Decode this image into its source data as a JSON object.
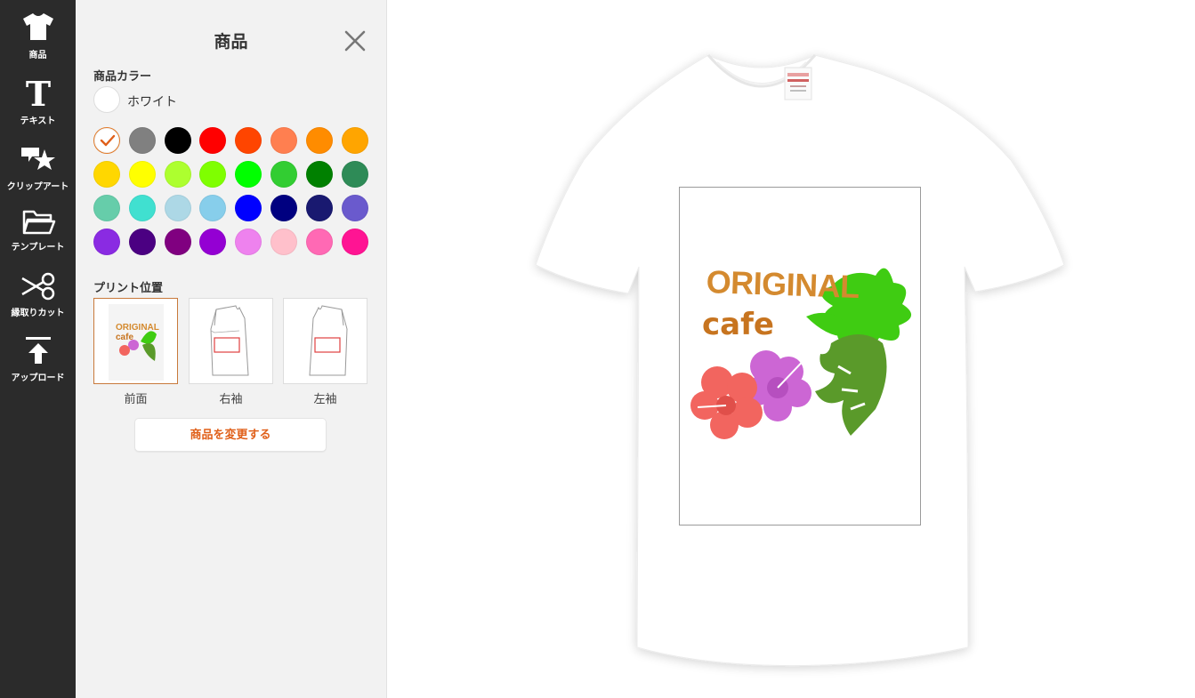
{
  "toolbar": {
    "items": [
      {
        "label": "商品",
        "icon": "tshirt-icon"
      },
      {
        "label": "テキスト",
        "icon": "text-icon"
      },
      {
        "label": "クリップアート",
        "icon": "clipart-icon"
      },
      {
        "label": "テンプレート",
        "icon": "folder-icon"
      },
      {
        "label": "縁取りカット",
        "icon": "scissors-icon"
      },
      {
        "label": "アップロード",
        "icon": "upload-icon"
      }
    ]
  },
  "panel": {
    "title": "商品",
    "color_section_label": "商品カラー",
    "selected_color_name": "ホワイト",
    "selected_color_hex": "#ffffff",
    "swatches": [
      "#ffffff",
      "#808080",
      "#000000",
      "#ff0000",
      "#ff4500",
      "#ff7f50",
      "#ff8c00",
      "#ffa500",
      "#ffd700",
      "#ffff00",
      "#adff2f",
      "#7fff00",
      "#00ff00",
      "#32cd32",
      "#008000",
      "#2e8b57",
      "#66cdaa",
      "#40e0d0",
      "#add8e6",
      "#87ceeb",
      "#0000ff",
      "#000080",
      "#191970",
      "#6a5acd",
      "#8a2be2",
      "#4b0082",
      "#800080",
      "#9400d3",
      "#ee82ee",
      "#ffc0cb",
      "#ff69b4",
      "#ff1493"
    ],
    "print_position_label": "プリント位置",
    "print_positions": [
      {
        "label": "前面"
      },
      {
        "label": "右袖"
      },
      {
        "label": "左袖"
      }
    ],
    "change_product_label": "商品を変更する"
  },
  "design": {
    "line1": "ORIGINAL",
    "line2": "cafe"
  },
  "colors": {
    "accent": "#e0601a",
    "toolbar_bg": "#2b2b2b",
    "panel_bg": "#f2f2f2",
    "title_text": "#d48a2f",
    "cafe_text": "#c7741f",
    "hibiscus_red": "#f2655f",
    "hibiscus_purple": "#cc66d4",
    "leaf_green": "#3fcc12",
    "monstera_green": "#5a9a2a"
  }
}
